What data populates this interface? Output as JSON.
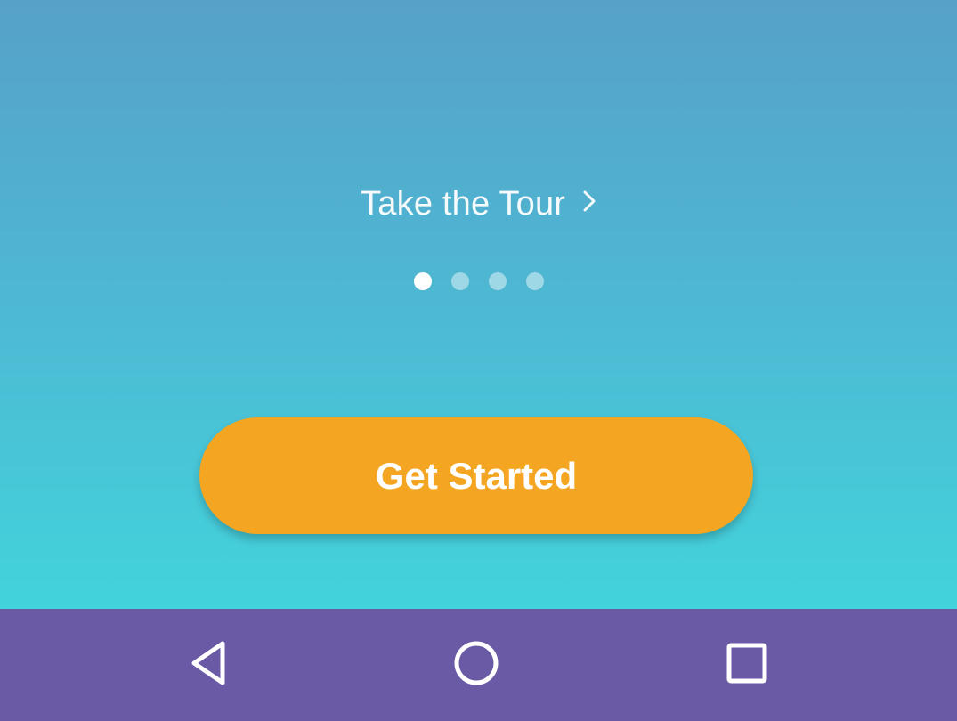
{
  "onboarding": {
    "tour_link_label": "Take the Tour",
    "tour_link_icon": "chevron-right-icon",
    "pager": {
      "total_pages": 4,
      "current_page": 1
    },
    "cta_label": "Get Started"
  },
  "navbar": {
    "back_icon": "back-triangle-icon",
    "home_icon": "home-circle-icon",
    "recents_icon": "recents-square-icon"
  },
  "colors": {
    "gradient_top": "#56a1c7",
    "gradient_bottom": "#42d3dc",
    "cta_background": "#f4a623",
    "navbar_background": "#6a5aa5"
  }
}
